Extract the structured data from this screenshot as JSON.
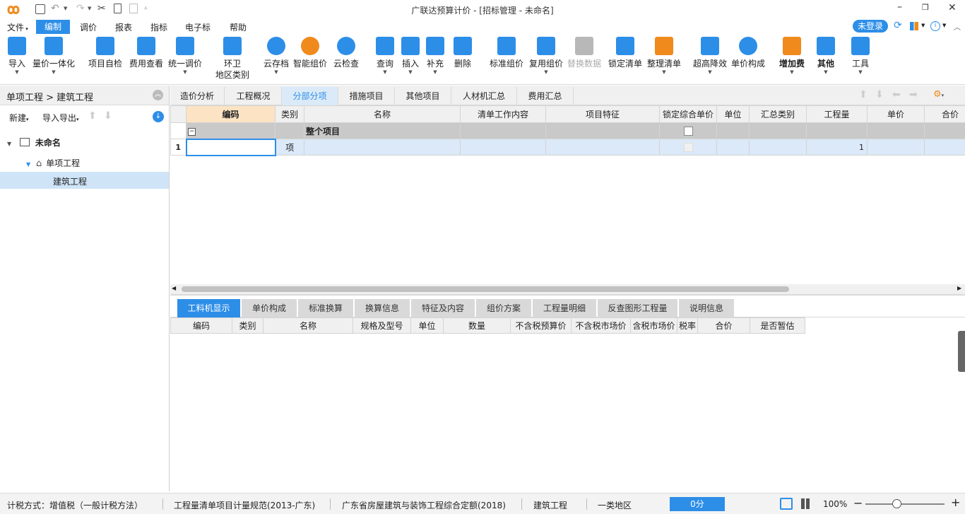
{
  "app": {
    "title": "广联达预算计价 - [招标管理 - 未命名]",
    "login_label": "未登录",
    "accent": "#2d8ee8"
  },
  "menu": [
    "文件",
    "编制",
    "调价",
    "报表",
    "指标",
    "电子标",
    "帮助"
  ],
  "toolbar": {
    "import": "导入",
    "price_integration": "量价一体化",
    "self_check": "项目自检",
    "fee_view": "费用查看",
    "unified_adjust": "统一调价",
    "sanitation_1": "环卫",
    "sanitation_2": "地区类别",
    "cloud_save": "云存档",
    "smart_price": "智能组价",
    "cloud_check": "云检查",
    "query": "查询",
    "insert": "插入",
    "supplement": "补充",
    "delete": "删除",
    "standard_price": "标准组价",
    "reuse_price": "复用组价",
    "replace_data": "替换数据",
    "lock_list": "锁定清单",
    "organize_list": "整理清单",
    "over_height": "超高降效",
    "unit_price_comp": "单价构成",
    "add_fee": "增加费",
    "other": "其他",
    "tools": "工具"
  },
  "left": {
    "breadcrumb": "单项工程 > 建筑工程",
    "new_label": "新建",
    "import_export_label": "导入导出",
    "tree": {
      "root": "未命名",
      "single": "单项工程",
      "unit": "建筑工程"
    }
  },
  "tabs": [
    "造价分析",
    "工程概况",
    "分部分项",
    "措施项目",
    "其他项目",
    "人材机汇总",
    "费用汇总"
  ],
  "grid": {
    "headers": [
      "编码",
      "类别",
      "名称",
      "清单工作内容",
      "项目特征",
      "锁定综合单价",
      "单位",
      "汇总类别",
      "工程量",
      "单价",
      "合价"
    ],
    "whole_project": "整个项目",
    "row1": {
      "num": "1",
      "type": "项",
      "quantity": "1"
    }
  },
  "bottom_tabs": [
    "工料机显示",
    "单价构成",
    "标准换算",
    "换算信息",
    "特征及内容",
    "组价方案",
    "工程量明细",
    "反查图形工程量",
    "说明信息"
  ],
  "bottom_headers": [
    "编码",
    "类别",
    "名称",
    "规格及型号",
    "单位",
    "数量",
    "不含税预算价",
    "不含税市场价",
    "含税市场价",
    "税率",
    "合价",
    "是否暂估"
  ],
  "status": {
    "tax_method": "计税方式：增值税（一般计税方法）",
    "spec": "工程量清单项目计量规范(2013-广东)",
    "quota": "广东省房屋建筑与装饰工程综合定额(2018)",
    "project": "建筑工程",
    "region": "一类地区",
    "score": "0分",
    "zoom": "100%"
  }
}
